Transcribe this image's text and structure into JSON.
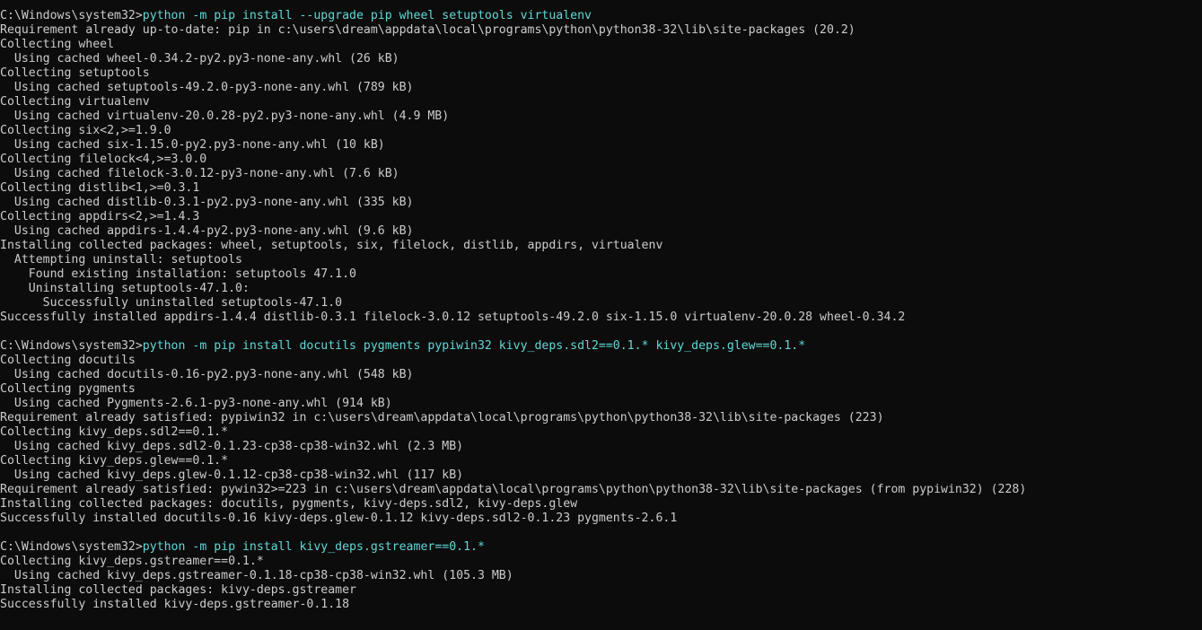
{
  "terminal": {
    "colors": {
      "background": "#0c0c0c",
      "text": "#cccccc",
      "command": "#61d6d6"
    },
    "lines": [
      {
        "prompt": "C:\\Windows\\system32>",
        "cmd": "python -m pip install --upgrade pip wheel setuptools virtualenv"
      },
      {
        "text": "Requirement already up-to-date: pip in c:\\users\\dream\\appdata\\local\\programs\\python\\python38-32\\lib\\site-packages (20.2)"
      },
      {
        "text": "Collecting wheel"
      },
      {
        "text": "  Using cached wheel-0.34.2-py2.py3-none-any.whl (26 kB)"
      },
      {
        "text": "Collecting setuptools"
      },
      {
        "text": "  Using cached setuptools-49.2.0-py3-none-any.whl (789 kB)"
      },
      {
        "text": "Collecting virtualenv"
      },
      {
        "text": "  Using cached virtualenv-20.0.28-py2.py3-none-any.whl (4.9 MB)"
      },
      {
        "text": "Collecting six<2,>=1.9.0"
      },
      {
        "text": "  Using cached six-1.15.0-py2.py3-none-any.whl (10 kB)"
      },
      {
        "text": "Collecting filelock<4,>=3.0.0"
      },
      {
        "text": "  Using cached filelock-3.0.12-py3-none-any.whl (7.6 kB)"
      },
      {
        "text": "Collecting distlib<1,>=0.3.1"
      },
      {
        "text": "  Using cached distlib-0.3.1-py2.py3-none-any.whl (335 kB)"
      },
      {
        "text": "Collecting appdirs<2,>=1.4.3"
      },
      {
        "text": "  Using cached appdirs-1.4.4-py2.py3-none-any.whl (9.6 kB)"
      },
      {
        "text": "Installing collected packages: wheel, setuptools, six, filelock, distlib, appdirs, virtualenv"
      },
      {
        "text": "  Attempting uninstall: setuptools"
      },
      {
        "text": "    Found existing installation: setuptools 47.1.0"
      },
      {
        "text": "    Uninstalling setuptools-47.1.0:"
      },
      {
        "text": "      Successfully uninstalled setuptools-47.1.0"
      },
      {
        "text": "Successfully installed appdirs-1.4.4 distlib-0.3.1 filelock-3.0.12 setuptools-49.2.0 six-1.15.0 virtualenv-20.0.28 wheel-0.34.2"
      },
      {
        "text": ""
      },
      {
        "prompt": "C:\\Windows\\system32>",
        "cmd": "python -m pip install docutils pygments pypiwin32 kivy_deps.sdl2==0.1.* kivy_deps.glew==0.1.*"
      },
      {
        "text": "Collecting docutils"
      },
      {
        "text": "  Using cached docutils-0.16-py2.py3-none-any.whl (548 kB)"
      },
      {
        "text": "Collecting pygments"
      },
      {
        "text": "  Using cached Pygments-2.6.1-py3-none-any.whl (914 kB)"
      },
      {
        "text": "Requirement already satisfied: pypiwin32 in c:\\users\\dream\\appdata\\local\\programs\\python\\python38-32\\lib\\site-packages (223)"
      },
      {
        "text": "Collecting kivy_deps.sdl2==0.1.*"
      },
      {
        "text": "  Using cached kivy_deps.sdl2-0.1.23-cp38-cp38-win32.whl (2.3 MB)"
      },
      {
        "text": "Collecting kivy_deps.glew==0.1.*"
      },
      {
        "text": "  Using cached kivy_deps.glew-0.1.12-cp38-cp38-win32.whl (117 kB)"
      },
      {
        "text": "Requirement already satisfied: pywin32>=223 in c:\\users\\dream\\appdata\\local\\programs\\python\\python38-32\\lib\\site-packages (from pypiwin32) (228)"
      },
      {
        "text": "Installing collected packages: docutils, pygments, kivy-deps.sdl2, kivy-deps.glew"
      },
      {
        "text": "Successfully installed docutils-0.16 kivy-deps.glew-0.1.12 kivy-deps.sdl2-0.1.23 pygments-2.6.1"
      },
      {
        "text": ""
      },
      {
        "prompt": "C:\\Windows\\system32>",
        "cmd": "python -m pip install kivy_deps.gstreamer==0.1.*"
      },
      {
        "text": "Collecting kivy_deps.gstreamer==0.1.*"
      },
      {
        "text": "  Using cached kivy_deps.gstreamer-0.1.18-cp38-cp38-win32.whl (105.3 MB)"
      },
      {
        "text": "Installing collected packages: kivy-deps.gstreamer"
      },
      {
        "text": "Successfully installed kivy-deps.gstreamer-0.1.18"
      }
    ]
  }
}
